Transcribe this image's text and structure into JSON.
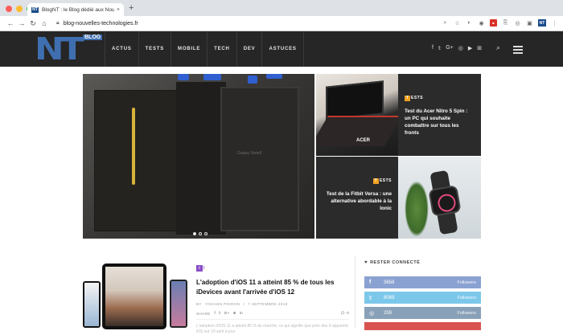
{
  "browser": {
    "tab_title": "BlogNT : le Blog dédié aux Nou",
    "tab_favicon": "NT",
    "tab_close": "×",
    "new_tab": "+",
    "url": "blog-nouvelles-technologies.fr",
    "nav": {
      "back": "←",
      "forward": "→",
      "reload": "↻",
      "home": "⌂"
    },
    "ext_nt_label": "NT",
    "menu_icon": "⋮"
  },
  "site": {
    "logo_text": "NT",
    "logo_badge": "BLOG",
    "nav": [
      "ACTUS",
      "TESTS",
      "MOBILE",
      "TECH",
      "DEV",
      "ASTUCES"
    ],
    "social_icons": [
      "f",
      "𝕥",
      "G+",
      "◎",
      "▶",
      "⊞"
    ],
    "search_icon": "⌕"
  },
  "hero": {
    "main_slide_box_text": "Galaxy Note9",
    "tiles": [
      {
        "tag": "ESTS",
        "tag_letter": "T",
        "title": "Test du Acer Nitro 5 Spin : un PC qui souhaite combattre sur tous les fronts"
      },
      {
        "tag": "ESTS",
        "tag_letter": "T",
        "title": "Test de la Fitbit Versa : une alternative abordable à la Ionic"
      }
    ],
    "laptop_brand": "ACER"
  },
  "article": {
    "tag_letter": "i",
    "tag": "I",
    "title": "L'adoption d'iOS 11 a atteint 85 % de tous les iDevices avant l'arrivée d'iOS 12",
    "meta_author_prefix": "BY",
    "meta_author": "YOHANN POIRON",
    "meta_date": "7 SEPTEMBRE 2018",
    "share_label": "SHARE",
    "share_icons": [
      "f",
      "𝕥",
      "G+",
      "⊕",
      "in"
    ],
    "comments": "0",
    "excerpt": "L'adoption d'iOS 11 a atteint 85 % du marché, ce qui signifie que près des 9 appareils iOS sur 10 sont à jour"
  },
  "sidebar": {
    "title": "RESTER CONNECTÉ",
    "social": [
      {
        "icon": "f",
        "count": "3658",
        "label": "Followers",
        "color": "#8aa2d1"
      },
      {
        "icon": "𝕥",
        "count": "8069",
        "label": "Followers",
        "color": "#7cc8ea"
      },
      {
        "icon": "◎",
        "count": "259",
        "label": "Followers",
        "color": "#89a1b8"
      }
    ]
  }
}
